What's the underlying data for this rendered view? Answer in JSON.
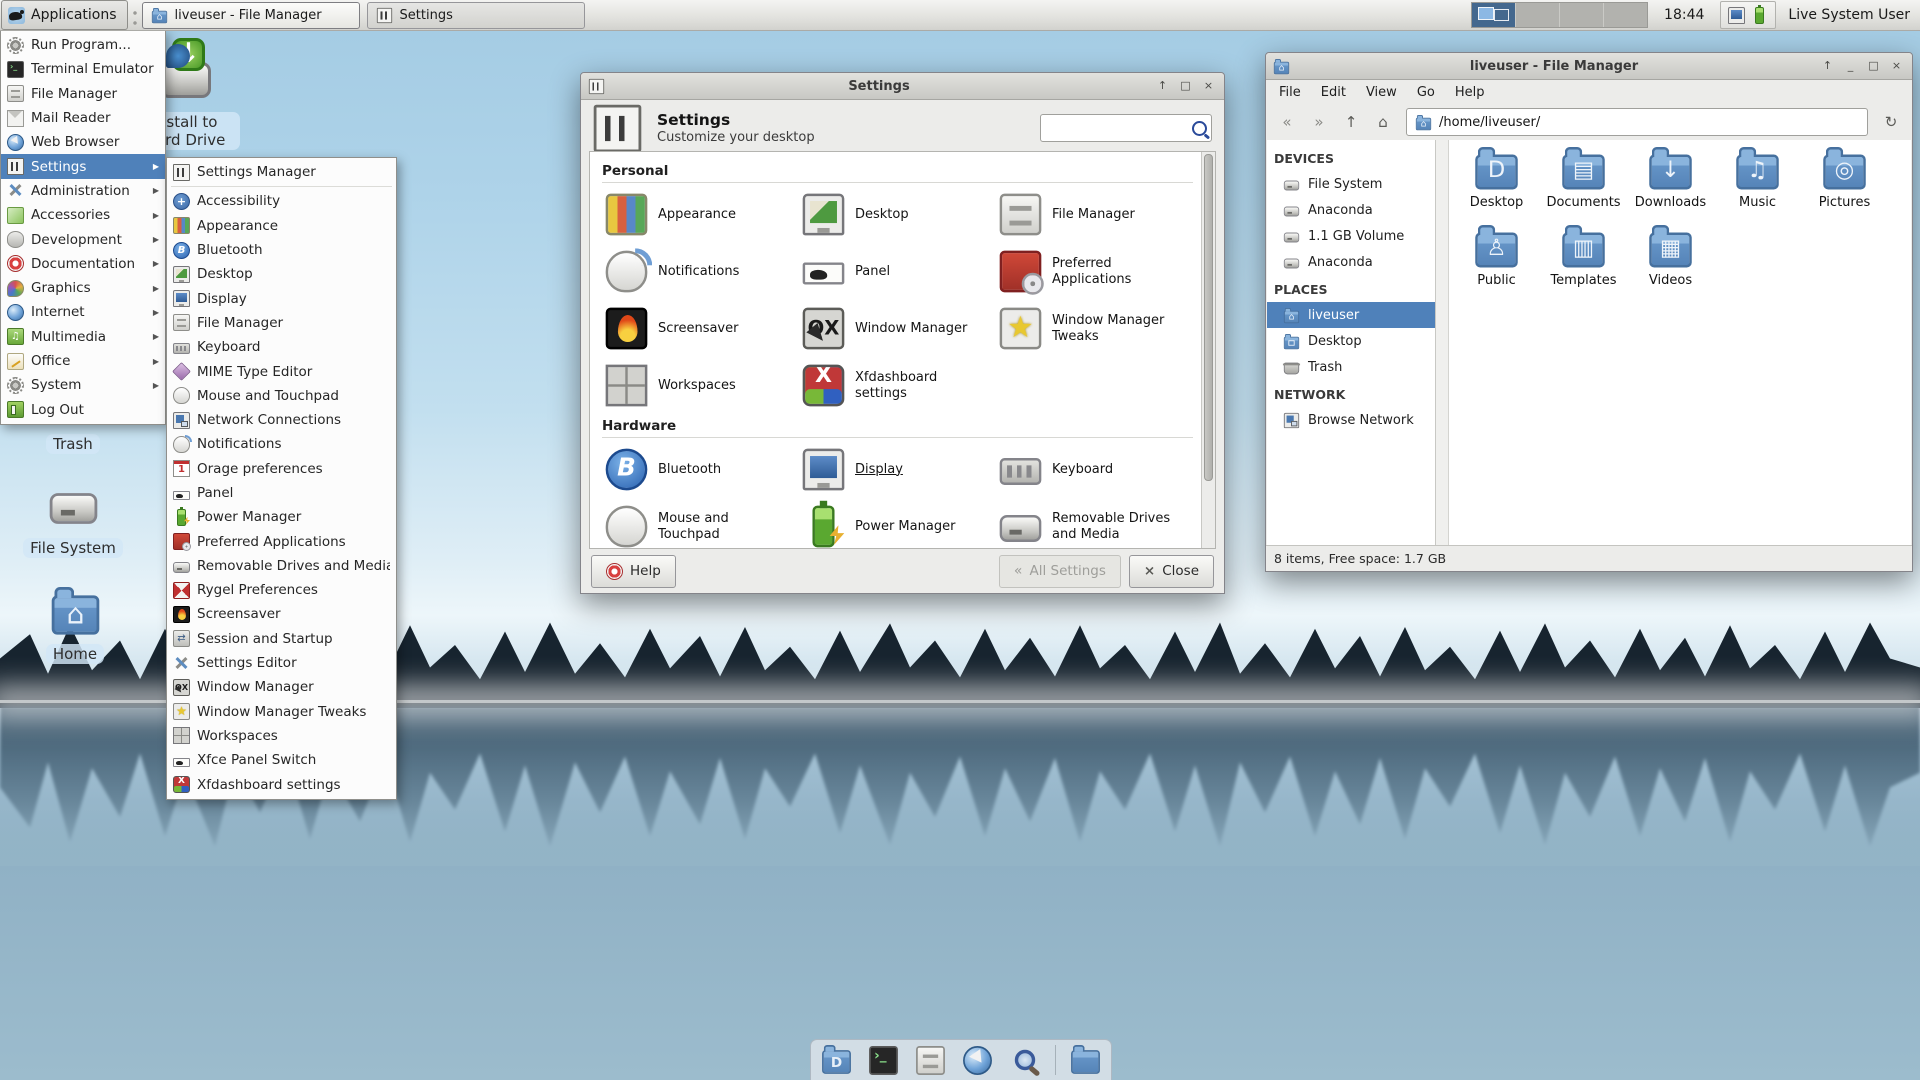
{
  "panel": {
    "applications_label": "Applications",
    "taskbar": [
      {
        "label": "liveuser - File Manager",
        "icon": "home-folder",
        "active": true
      },
      {
        "label": "Settings",
        "icon": "settings-manager",
        "active": false
      }
    ],
    "workspace_count": 4,
    "clock": "18:44",
    "tray_icons": [
      "tray-display",
      "battery"
    ],
    "user_label": "Live System User"
  },
  "applications_menu": {
    "items": [
      {
        "label": "Run Program...",
        "icon": "run"
      },
      {
        "label": "Terminal Emulator",
        "icon": "terminal"
      },
      {
        "label": "File Manager",
        "icon": "file-manager"
      },
      {
        "label": "Mail Reader",
        "icon": "mail"
      },
      {
        "label": "Web Browser",
        "icon": "web-browser"
      },
      {
        "label": "Settings",
        "icon": "settings-manager",
        "submenu": true,
        "selected": true
      },
      {
        "label": "Administration",
        "icon": "administration",
        "submenu": true
      },
      {
        "label": "Accessories",
        "icon": "accessories",
        "submenu": true
      },
      {
        "label": "Development",
        "icon": "development",
        "submenu": true
      },
      {
        "label": "Documentation",
        "icon": "documentation",
        "submenu": true
      },
      {
        "label": "Graphics",
        "icon": "graphics",
        "submenu": true
      },
      {
        "label": "Internet",
        "icon": "internet",
        "submenu": true
      },
      {
        "label": "Multimedia",
        "icon": "multimedia",
        "submenu": true
      },
      {
        "label": "Office",
        "icon": "office",
        "submenu": true
      },
      {
        "label": "System",
        "icon": "system",
        "submenu": true
      },
      {
        "label": "Log Out",
        "icon": "logout"
      }
    ]
  },
  "settings_submenu": {
    "items": [
      {
        "label": "Settings Manager",
        "icon": "settings-manager",
        "separator_after": true
      },
      {
        "label": "Accessibility",
        "icon": "accessibility"
      },
      {
        "label": "Appearance",
        "icon": "appearance"
      },
      {
        "label": "Bluetooth",
        "icon": "bluetooth"
      },
      {
        "label": "Desktop",
        "icon": "desktop-settings"
      },
      {
        "label": "Display",
        "icon": "display"
      },
      {
        "label": "File Manager",
        "icon": "file-manager"
      },
      {
        "label": "Keyboard",
        "icon": "keyboard"
      },
      {
        "label": "MIME Type Editor",
        "icon": "mime"
      },
      {
        "label": "Mouse and Touchpad",
        "icon": "mouse"
      },
      {
        "label": "Network Connections",
        "icon": "network"
      },
      {
        "label": "Notifications",
        "icon": "notifications"
      },
      {
        "label": "Orage preferences",
        "icon": "orage"
      },
      {
        "label": "Panel",
        "icon": "panel"
      },
      {
        "label": "Power Manager",
        "icon": "power"
      },
      {
        "label": "Preferred Applications",
        "icon": "preferred-apps"
      },
      {
        "label": "Removable Drives and Media",
        "icon": "removable"
      },
      {
        "label": "Rygel Preferences",
        "icon": "rygel"
      },
      {
        "label": "Screensaver",
        "icon": "screensaver"
      },
      {
        "label": "Session and Startup",
        "icon": "session"
      },
      {
        "label": "Settings Editor",
        "icon": "settings-editor"
      },
      {
        "label": "Window Manager",
        "icon": "window-manager"
      },
      {
        "label": "Window Manager Tweaks",
        "icon": "wm-tweaks"
      },
      {
        "label": "Workspaces",
        "icon": "workspaces"
      },
      {
        "label": "Xfce Panel Switch",
        "icon": "panel-switch"
      },
      {
        "label": "Xfdashboard settings",
        "icon": "xfdashboard"
      }
    ]
  },
  "desktop_icons": [
    {
      "label": "Install to Hard Drive",
      "icon": "install-drive"
    },
    {
      "label": "Trash",
      "icon": "trash"
    },
    {
      "label": "File System",
      "icon": "drive"
    },
    {
      "label": "Home",
      "icon": "home-folder-big"
    }
  ],
  "settings_window": {
    "titlebar": {
      "title": "Settings",
      "buttons": [
        "shade",
        "maximize",
        "close"
      ]
    },
    "header": {
      "title": "Settings",
      "subtitle": "Customize your desktop",
      "search_value": ""
    },
    "sections": [
      {
        "title": "Personal",
        "items": [
          {
            "label": "Appearance",
            "icon": "appearance"
          },
          {
            "label": "Desktop",
            "icon": "desktop-settings"
          },
          {
            "label": "File Manager",
            "icon": "file-manager"
          },
          {
            "label": "Notifications",
            "icon": "notifications"
          },
          {
            "label": "Panel",
            "icon": "panel"
          },
          {
            "label": "Preferred Applications",
            "icon": "preferred-apps"
          },
          {
            "label": "Screensaver",
            "icon": "screensaver"
          },
          {
            "label": "Window Manager",
            "icon": "window-manager"
          },
          {
            "label": "Window Manager Tweaks",
            "icon": "wm-tweaks"
          },
          {
            "label": "Workspaces",
            "icon": "workspaces"
          },
          {
            "label": "Xfdashboard settings",
            "icon": "xfdashboard"
          }
        ]
      },
      {
        "title": "Hardware",
        "items": [
          {
            "label": "Bluetooth",
            "icon": "bluetooth"
          },
          {
            "label": "Display",
            "icon": "display",
            "underlined": true
          },
          {
            "label": "Keyboard",
            "icon": "keyboard"
          },
          {
            "label": "Mouse and Touchpad",
            "icon": "mouse"
          },
          {
            "label": "Power Manager",
            "icon": "power"
          },
          {
            "label": "Removable Drives and Media",
            "icon": "removable"
          }
        ]
      }
    ],
    "footer_buttons": [
      {
        "label": "Help",
        "icon": "help",
        "enabled": true
      },
      {
        "label": "All Settings",
        "icon": "all-settings",
        "enabled": false
      },
      {
        "label": "Close",
        "icon": "close",
        "enabled": true
      }
    ]
  },
  "file_manager": {
    "titlebar": {
      "title": "liveuser - File Manager",
      "buttons": [
        "shade",
        "minimize",
        "maximize",
        "close"
      ]
    },
    "menubar": [
      "File",
      "Edit",
      "View",
      "Go",
      "Help"
    ],
    "toolbar": {
      "nav": [
        "back",
        "forward",
        "up",
        "home"
      ],
      "path": "/home/liveuser/",
      "reload": "reload"
    },
    "sidebar": [
      {
        "title": "DEVICES",
        "items": [
          {
            "label": "File System",
            "icon": "drive"
          },
          {
            "label": "Anaconda",
            "icon": "drive"
          },
          {
            "label": "1.1 GB Volume",
            "icon": "drive"
          },
          {
            "label": "Anaconda",
            "icon": "drive"
          }
        ]
      },
      {
        "title": "PLACES",
        "items": [
          {
            "label": "liveuser",
            "icon": "home-folder",
            "selected": true
          },
          {
            "label": "Desktop",
            "icon": "folder-desktop-sm"
          },
          {
            "label": "Trash",
            "icon": "trash-sm"
          }
        ]
      },
      {
        "title": "NETWORK",
        "items": [
          {
            "label": "Browse Network",
            "icon": "network"
          }
        ]
      }
    ],
    "folders": [
      {
        "label": "Desktop",
        "emblem": "desktop"
      },
      {
        "label": "Documents",
        "emblem": "documents"
      },
      {
        "label": "Downloads",
        "emblem": "downloads"
      },
      {
        "label": "Music",
        "emblem": "music"
      },
      {
        "label": "Pictures",
        "emblem": "pictures"
      },
      {
        "label": "Public",
        "emblem": "public"
      },
      {
        "label": "Templates",
        "emblem": "templates"
      },
      {
        "label": "Videos",
        "emblem": "videos"
      }
    ],
    "statusbar": "8 items, Free space: 1.7 GB"
  },
  "dock": {
    "items": [
      "show-desktop",
      "terminal-emulator",
      "file-manager-launcher",
      "web-browser-launcher",
      "application-finder",
      "directory-menu"
    ]
  }
}
